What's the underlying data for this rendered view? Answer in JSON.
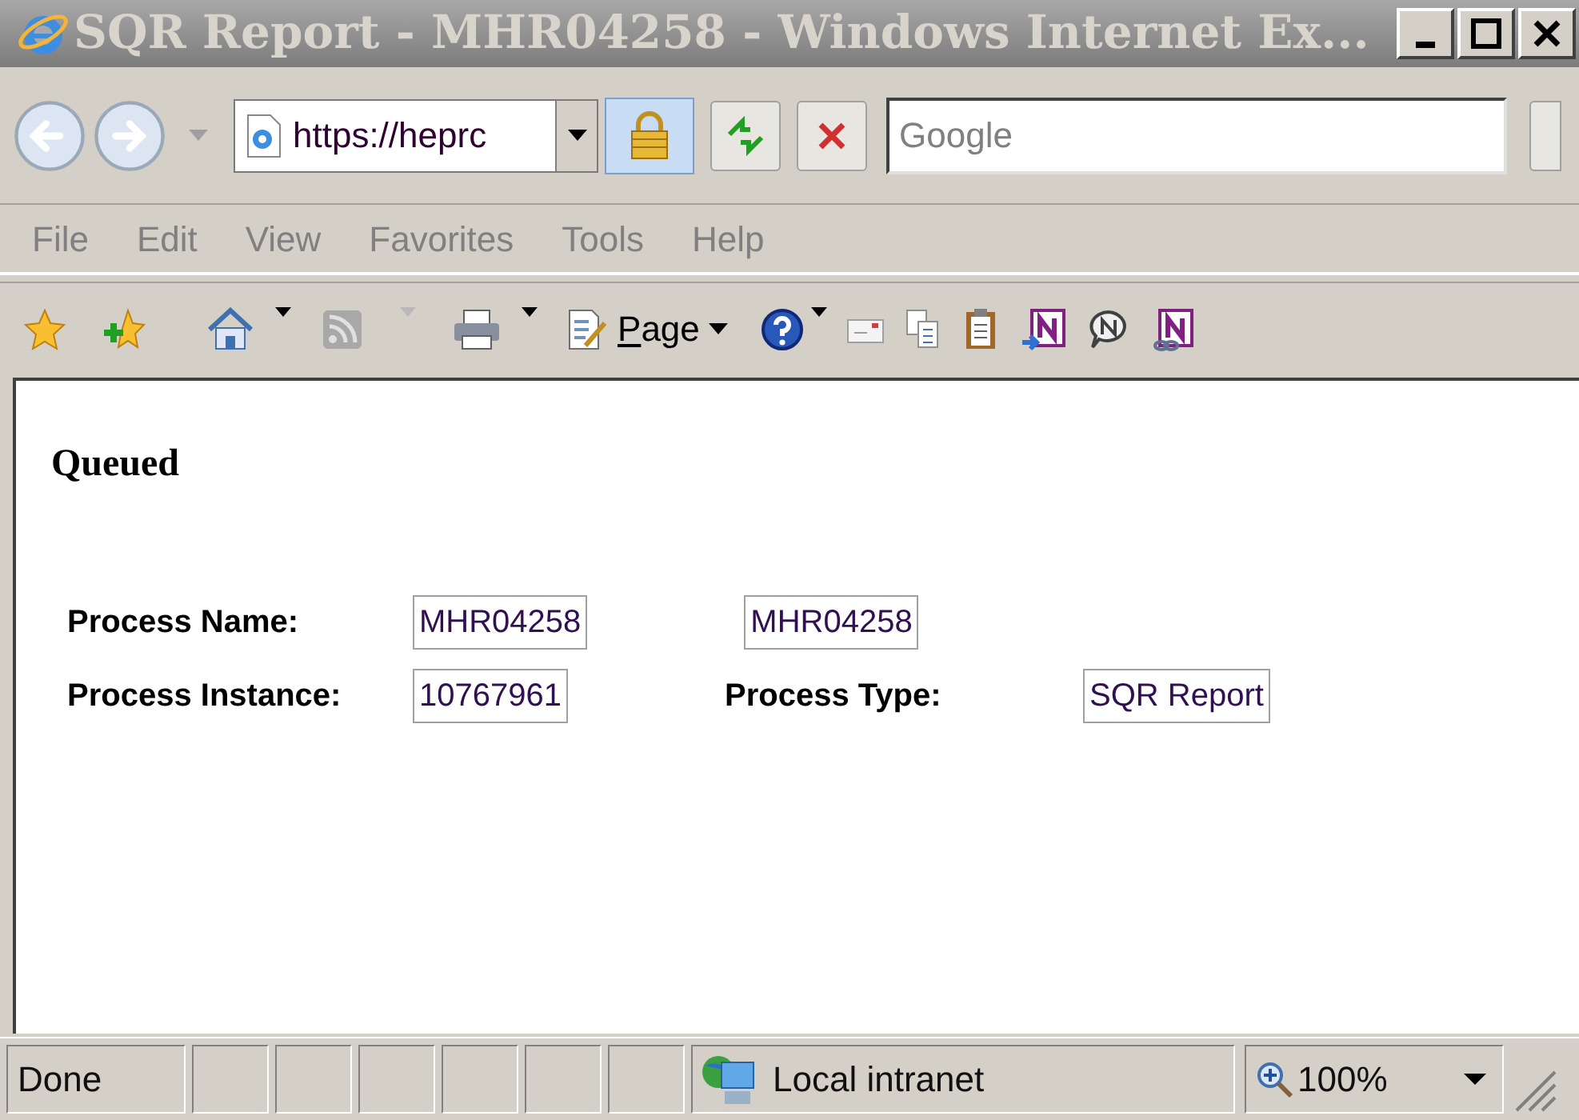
{
  "window": {
    "title": "SQR Report - MHR04258 - Windows Internet Ex..."
  },
  "address_bar": {
    "value": "https://heprc"
  },
  "search": {
    "placeholder": "Google"
  },
  "menu": [
    {
      "label": "File"
    },
    {
      "label": "Edit"
    },
    {
      "label": "View"
    },
    {
      "label": "Favorites"
    },
    {
      "label": "Tools"
    },
    {
      "label": "Help"
    }
  ],
  "toolbar": {
    "page_button": "Page"
  },
  "content": {
    "heading": "Queued",
    "rows": [
      {
        "label": "Process Name:",
        "value": "MHR04258",
        "value_2": "MHR04258"
      },
      {
        "label": "Process Instance:",
        "value": "10767961",
        "label_2": "Process Type:",
        "value_2": "SQR Report"
      }
    ]
  },
  "status_bar": {
    "status": "Done",
    "zone": "Local intranet",
    "zoom": "100%"
  }
}
